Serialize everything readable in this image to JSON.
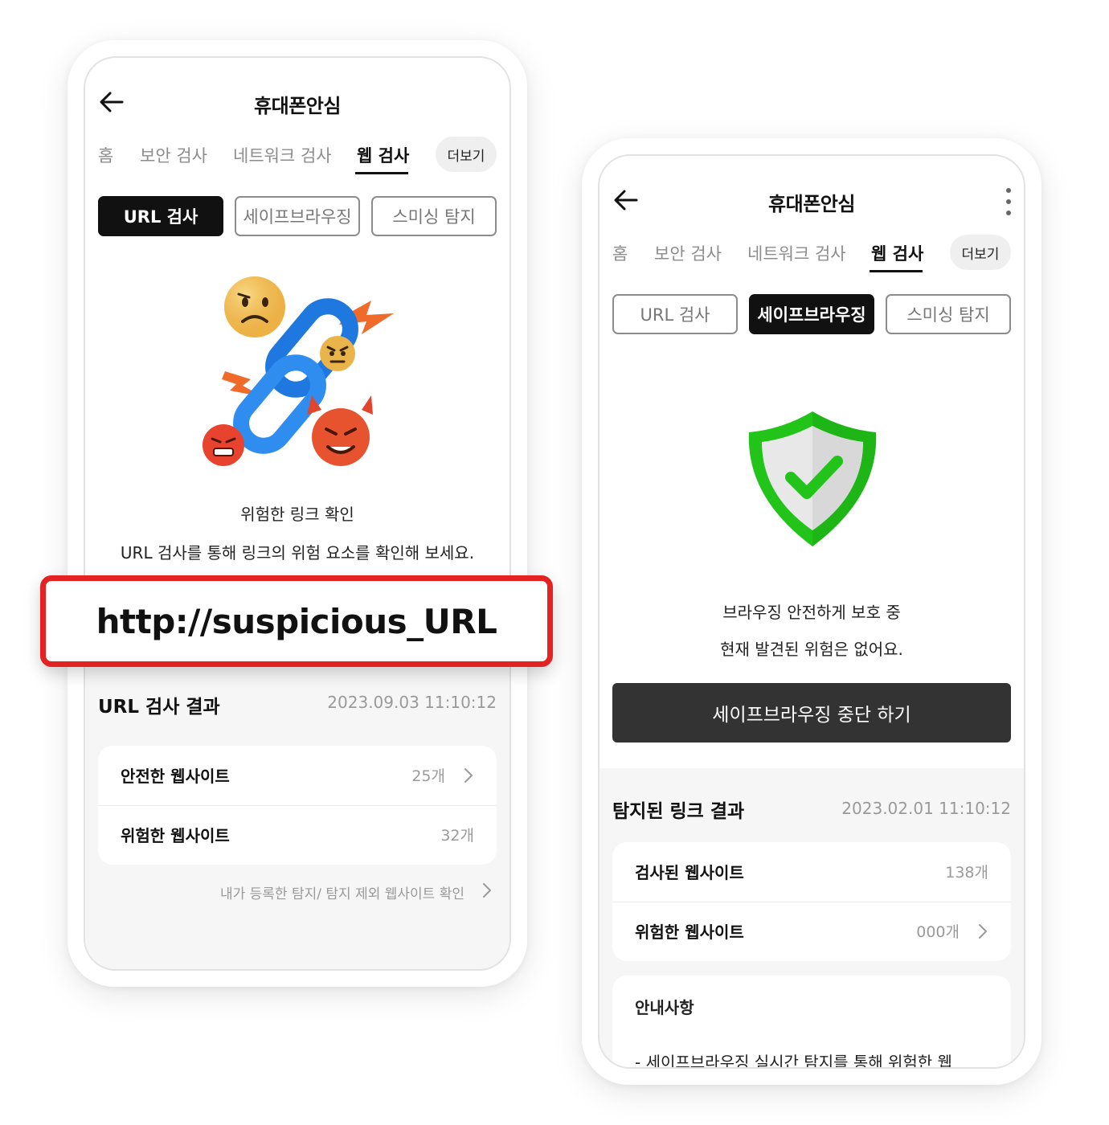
{
  "left_screen": {
    "title": "휴대폰안심",
    "tabs": [
      "홈",
      "보안 검사",
      "네트워크 검사",
      "웹 검사"
    ],
    "more_label": "더보기",
    "segments": [
      "URL 검사",
      "세이프브라우징",
      "스미싱 탐지"
    ],
    "hero_title": "위험한 링크 확인",
    "hero_subtitle": "URL 검사를 통해 링크의 위험 요소를 확인해 보세요.",
    "result_title": "URL 검사 결과",
    "result_date": "2023.09.03 11:10:12",
    "rows": [
      {
        "label": "안전한 웹사이트",
        "value": "25개"
      },
      {
        "label": "위험한 웹사이트",
        "value": "32개"
      }
    ],
    "footnote": "내가 등록한 탐지/ 탐지 제외 웹사이트 확인"
  },
  "url_overlay": "http://suspicious_URL",
  "right_screen": {
    "title": "휴대폰안심",
    "tabs": [
      "홈",
      "보안 검사",
      "네트워크 검사",
      "웹 검사"
    ],
    "more_label": "더보기",
    "segments": [
      "URL 검사",
      "세이프브라우징",
      "스미싱 탐지"
    ],
    "status_title": "브라우징 안전하게 보호 중",
    "status_subtitle": "현재 발견된 위험은 없어요.",
    "stop_button": "세이프브라우징 중단 하기",
    "result_title": "탐지된 링크 결과",
    "result_date": "2023.02.01 11:10:12",
    "rows": [
      {
        "label": "검사된 웹사이트",
        "value": "138개"
      },
      {
        "label": "위험한 웹사이트",
        "value": "000개"
      }
    ],
    "notice_title": "안내사항",
    "notice_text": "- 세이프브라우징 실시간 탐지를 통해 위험한 웹"
  },
  "colors": {
    "accent_red": "#e52222",
    "shield_green": "#22c41a",
    "dark_button": "#333333",
    "chain_blue": "#1f78e0"
  },
  "icons": {
    "back": "arrow-left-icon",
    "more": "kebab-menu-icon",
    "row_link": "chevron-right-icon",
    "hero_left": "broken-chain-with-angry-emojis",
    "hero_right": "green-shield-checkmark"
  }
}
